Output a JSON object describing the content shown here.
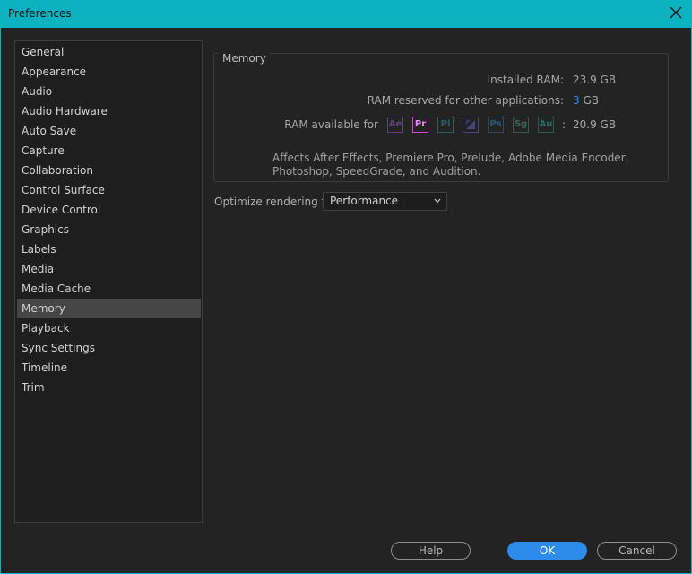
{
  "window": {
    "title": "Preferences"
  },
  "sidebar": {
    "items": [
      {
        "label": "General"
      },
      {
        "label": "Appearance"
      },
      {
        "label": "Audio"
      },
      {
        "label": "Audio Hardware"
      },
      {
        "label": "Auto Save"
      },
      {
        "label": "Capture"
      },
      {
        "label": "Collaboration"
      },
      {
        "label": "Control Surface"
      },
      {
        "label": "Device Control"
      },
      {
        "label": "Graphics"
      },
      {
        "label": "Labels"
      },
      {
        "label": "Media"
      },
      {
        "label": "Media Cache"
      },
      {
        "label": "Memory"
      },
      {
        "label": "Playback"
      },
      {
        "label": "Sync Settings"
      },
      {
        "label": "Timeline"
      },
      {
        "label": "Trim"
      }
    ],
    "selected": "Memory"
  },
  "memory": {
    "section_title": "Memory",
    "installed_label": "Installed RAM:",
    "installed_value": "23.9 GB",
    "reserved_label": "RAM reserved for other applications:",
    "reserved_value": "3",
    "reserved_unit": "GB",
    "available_label": "RAM available for",
    "available_value": "20.9 GB",
    "colon": ":",
    "apps": [
      {
        "abbr": "Ae",
        "color": "#5b4575",
        "text_color": "#5b4575",
        "icon": "after-effects-icon"
      },
      {
        "abbr": "Pr",
        "color": "#cf46e0",
        "text_color": "#e68cf2",
        "icon": "premiere-pro-icon"
      },
      {
        "abbr": "Pl",
        "color": "#2f5c5c",
        "text_color": "#2f5c5c",
        "icon": "prelude-icon"
      },
      {
        "abbr": "",
        "color": "#464677",
        "text_color": "#464677",
        "icon": "media-encoder-icon"
      },
      {
        "abbr": "Ps",
        "color": "#2c4a63",
        "text_color": "#2e5a7a",
        "icon": "photoshop-icon"
      },
      {
        "abbr": "Sg",
        "color": "#335a4a",
        "text_color": "#3f6b55",
        "icon": "speedgrade-icon"
      },
      {
        "abbr": "Au",
        "color": "#2c5950",
        "text_color": "#2c6a5c",
        "icon": "audition-icon"
      }
    ],
    "description": "Affects After Effects, Premiere Pro, Prelude, Adobe Media Encoder, Photoshop, SpeedGrade, and Audition."
  },
  "optimize": {
    "label": "Optimize rendering for:",
    "value": "Performance"
  },
  "buttons": {
    "help": "Help",
    "ok": "OK",
    "cancel": "Cancel"
  },
  "colors": {
    "accent": "#0cb2bf",
    "primary": "#2d8ceb",
    "selected_bg": "#464646"
  }
}
